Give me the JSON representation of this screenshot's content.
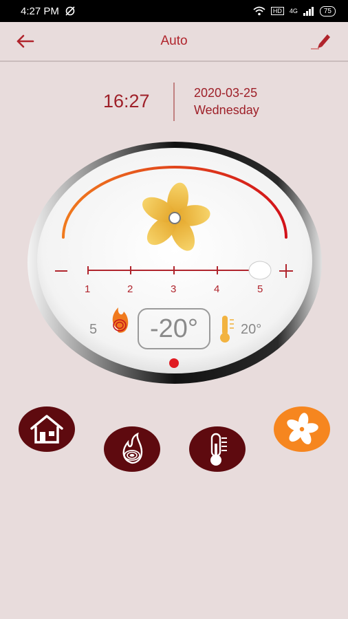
{
  "status_bar": {
    "time": "4:27 PM",
    "network": "HD",
    "signal": "4G",
    "battery": "75"
  },
  "header": {
    "title": "Auto",
    "back_icon": "arrow-left-icon",
    "edit_icon": "pencil-icon"
  },
  "datetime": {
    "time": "16:27",
    "date": "2020-03-25",
    "weekday": "Wednesday"
  },
  "dial": {
    "fan_icon": "fan-icon",
    "slider": {
      "ticks": [
        "1",
        "2",
        "3",
        "4",
        "5"
      ],
      "value": 5,
      "min_label": "−",
      "max_label": "+"
    },
    "fire_level": "5",
    "set_temperature": "-20°",
    "room_temperature": "20°"
  },
  "modes": [
    {
      "name": "home",
      "icon": "home-icon",
      "active": false
    },
    {
      "name": "fire",
      "icon": "flame-icon",
      "active": false
    },
    {
      "name": "thermostat",
      "icon": "thermometer-icon",
      "active": false
    },
    {
      "name": "fan",
      "icon": "fan-icon",
      "active": true
    }
  ],
  "colors": {
    "accent": "#b0242c",
    "dark_red": "#5a0a0e",
    "orange": "#f6861f",
    "background": "#e8dcdc"
  }
}
